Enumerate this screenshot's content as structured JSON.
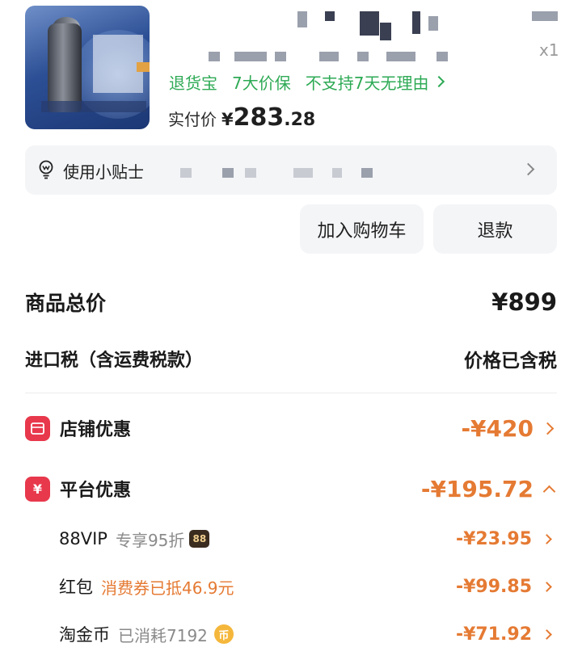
{
  "product": {
    "quantity": "x1",
    "services": [
      "退货宝",
      "7大价保",
      "不支持7天无理由"
    ],
    "paid_label": "实付价",
    "paid_currency": "¥",
    "paid_integer": "283",
    "paid_decimal": ".28"
  },
  "tip": {
    "label": "使用小贴士"
  },
  "actions": {
    "add_to_cart": "加入购物车",
    "refund": "退款"
  },
  "price_detail": {
    "total_label": "商品总价",
    "total_value": "¥899",
    "tax_label": "进口税（含运费税款）",
    "tax_value": "价格已含税",
    "store_discount_label": "店铺优惠",
    "store_discount_value": "-¥420",
    "platform_discount_label": "平台优惠",
    "platform_discount_value": "-¥195.72",
    "platform_items": [
      {
        "label": "88VIP",
        "note": "专享95折",
        "badge": "88",
        "value": "-¥23.95"
      },
      {
        "label": "红包",
        "note": "消费券已抵46.9元",
        "value": "-¥99.85"
      },
      {
        "label": "淘金币",
        "note": "已消耗7192",
        "badge": "币",
        "value": "-¥71.92"
      }
    ]
  },
  "colors": {
    "service_green": "#2eaa55",
    "discount_orange": "#e57a33",
    "discount_icon_red": "#e8384c"
  },
  "icons": [
    "lightbulb-icon",
    "store-icon",
    "platform-coupon-icon",
    "coin-icon",
    "chevron-right-icon",
    "chevron-up-icon"
  ]
}
